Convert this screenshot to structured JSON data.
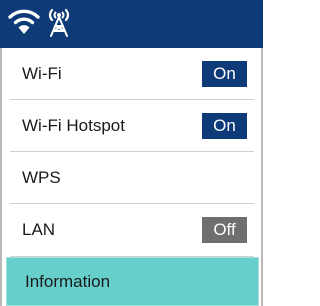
{
  "status_bar": {
    "icons": [
      "wifi-icon",
      "antenna-icon"
    ],
    "background_color": "#0e3a78"
  },
  "menu": {
    "items": [
      {
        "label": "Wi-Fi",
        "toggle": "On",
        "toggle_state": "on"
      },
      {
        "label": "Wi-Fi Hotspot",
        "toggle": "On",
        "toggle_state": "on"
      },
      {
        "label": "WPS"
      },
      {
        "label": "LAN",
        "toggle": "Off",
        "toggle_state": "off"
      },
      {
        "label": "Information",
        "selected": true
      }
    ]
  },
  "colors": {
    "accent": "#0e3a78",
    "selected_row": "#66cfcc",
    "toggle_off": "#6f6f6f"
  }
}
